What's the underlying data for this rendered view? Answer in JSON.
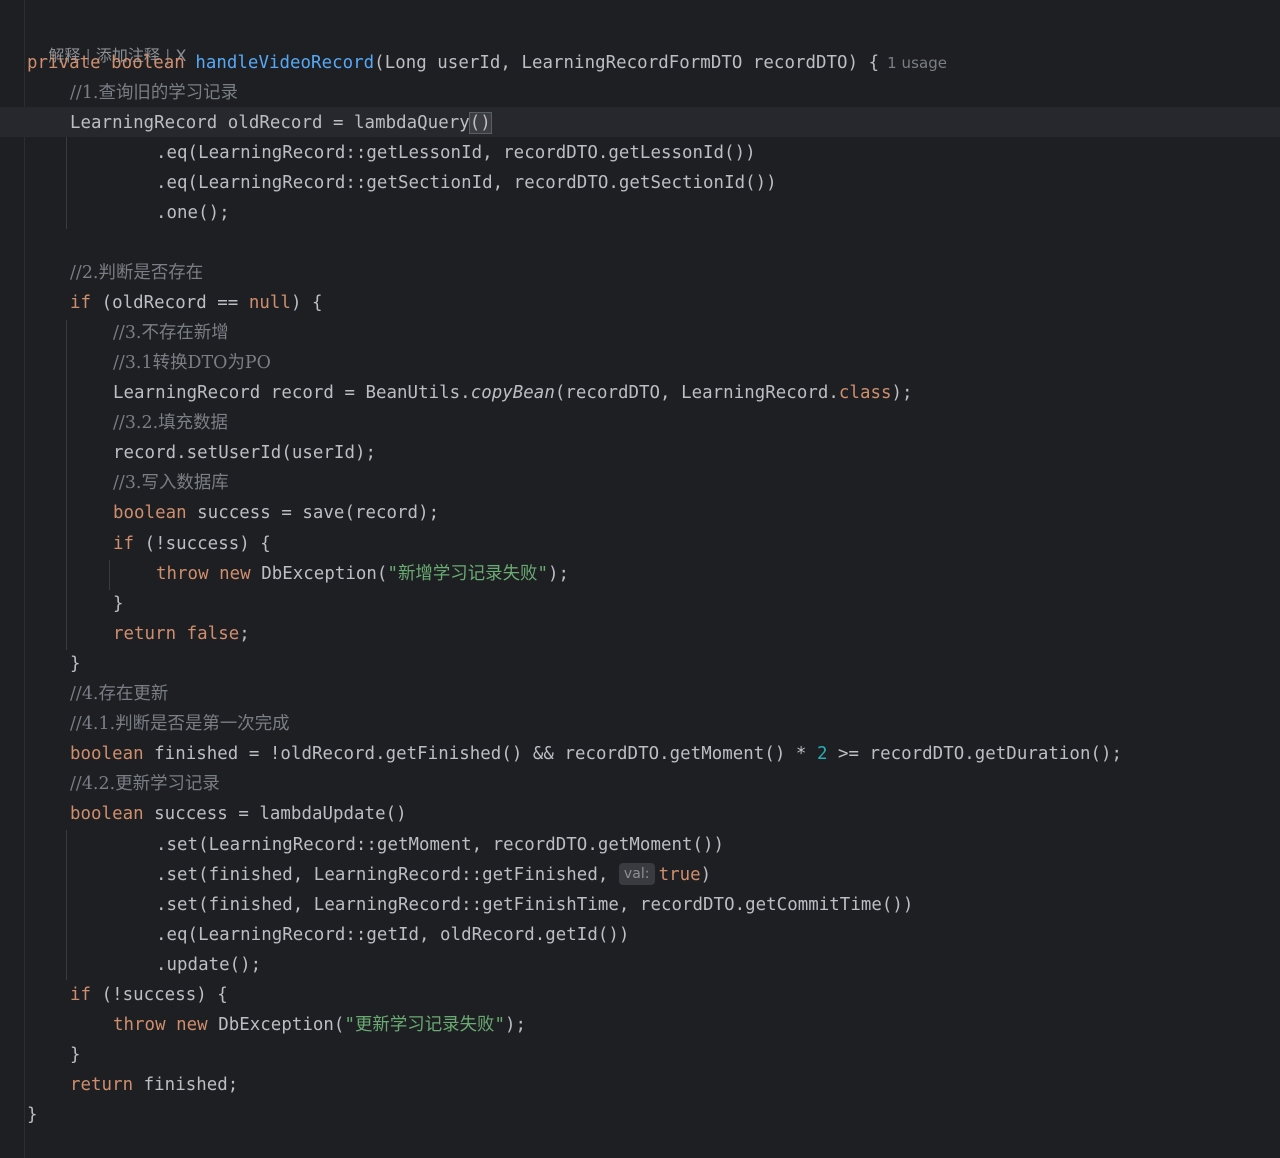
{
  "lens": {
    "explain": "解释",
    "add_comment": "添加注释",
    "close": "X"
  },
  "usage_hint": "1 usage",
  "param_hint": "val:",
  "code": {
    "l1_kw": "private boolean ",
    "l1_fn": "handleVideoRecord",
    "l1_rest": "(Long userId, LearningRecordFormDTO recordDTO) {",
    "c1": "//1.查询旧的学习记录",
    "l3_a": "LearningRecord oldRecord = lambdaQuery",
    "l3_b": "()",
    "l4": ".eq(LearningRecord::getLessonId, recordDTO.getLessonId())",
    "l5": ".eq(LearningRecord::getSectionId, recordDTO.getSectionId())",
    "l6": ".one();",
    "c2": "//2.判断是否存在",
    "l8_kw": "if",
    "l8_a": " (oldRecord == ",
    "l8_null": "null",
    "l8_b": ") {",
    "c3": "//3.不存在新增",
    "c31": "//3.1转换DTO为PO",
    "l11_a": "LearningRecord record = BeanUtils.",
    "l11_it": "copyBean",
    "l11_b": "(recordDTO, LearningRecord.",
    "l11_class": "class",
    "l11_c": ");",
    "c32": "//3.2.填充数据",
    "l13": "record.setUserId(userId);",
    "c33": "//3.写入数据库",
    "l15_kw": "boolean",
    "l15_rest": " success = save(record);",
    "l16_kw": "if",
    "l16_rest": " (!success) {",
    "l17_kw": "throw new",
    "l17_a": " DbException(",
    "l17_str": "\"新增学习记录失败\"",
    "l17_b": ");",
    "close_brace": "}",
    "l19_kw": "return false",
    "l19_b": ";",
    "c4": "//4.存在更新",
    "c41": "//4.1.判断是否是第一次完成",
    "l23_kw": "boolean",
    "l23_a": " finished = !oldRecord.getFinished() && recordDTO.getMoment() * ",
    "l23_num": "2",
    "l23_b": " >= recordDTO.getDuration();",
    "c42": "//4.2.更新学习记录",
    "l25_kw": "boolean",
    "l25_rest": " success = lambdaUpdate()",
    "l26": ".set(LearningRecord::getMoment, recordDTO.getMoment())",
    "l27_a": ".set(finished, LearningRecord::getFinished, ",
    "l27_true": "true",
    "l27_b": ")",
    "l28": ".set(finished, LearningRecord::getFinishTime, recordDTO.getCommitTime())",
    "l29": ".eq(LearningRecord::getId, oldRecord.getId())",
    "l30": ".update();",
    "l31_kw": "if",
    "l31_rest": " (!success) {",
    "l32_kw": "throw new",
    "l32_a": " DbException(",
    "l32_str": "\"更新学习记录失败\"",
    "l32_b": ");",
    "l34_kw": "return",
    "l34_rest": " finished;"
  },
  "colors": {
    "background": "#1e1f22",
    "keyword": "#cf8e6d",
    "method_decl": "#56a8f5",
    "comment": "#7a7e85",
    "string": "#6aab73",
    "number": "#2aacb8",
    "default_text": "#bcbec4"
  }
}
